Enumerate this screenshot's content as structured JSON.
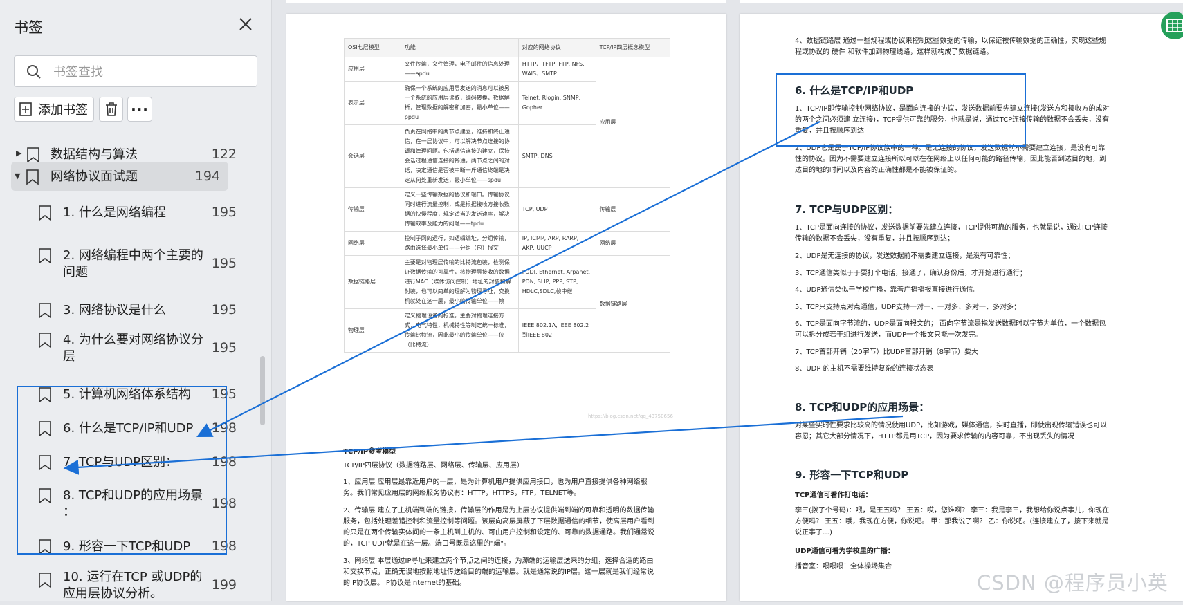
{
  "sidebar": {
    "title": "书签",
    "search_placeholder": "书签查找",
    "add_label": "添加书签",
    "bookmarks": [
      {
        "label": "数据结构与算法",
        "page": "122"
      },
      {
        "label": "网络协议面试题",
        "page": "194"
      },
      {
        "label": "1. 什么是网络编程",
        "page": "195"
      },
      {
        "label": "2. 网络编程中两个主要的",
        "label2": "问题",
        "page": "195"
      },
      {
        "label": "3. 网络协议是什么",
        "page": "195"
      },
      {
        "label": "4. 为什么要对网络协议分",
        "label2": "层",
        "page": "195"
      },
      {
        "label": "5. 计算机网络体系结构",
        "page": "195"
      },
      {
        "label": "6. 什么是TCP/IP和UDP",
        "page": "198"
      },
      {
        "label": "7. TCP与UDP区别：",
        "page": "198"
      },
      {
        "label": "8. TCP和UDP的应用场景",
        "label2": "：",
        "page": "198"
      },
      {
        "label": "9. 形容一下TCP和UDP",
        "page": "198"
      },
      {
        "label": "10. 运行在TCP 或UDP的",
        "label2": "应用层协议分析。",
        "page": "199"
      }
    ]
  },
  "osi_table": {
    "headers": [
      "OSI七层模型",
      "功能",
      "对应的网络协议",
      "TCP/IP四层概念模型"
    ],
    "rows": [
      {
        "layer": "应用层",
        "func": "文件传输，文件管理，电子邮件的信息处理——apdu",
        "proto": "HTTP、TFTP, FTP, NFS, WAIS、SMTP"
      },
      {
        "layer": "表示层",
        "func": "确保一个系统的应用层发送的消息可以被另一个系统的应用层读取，编码转换，数据解析，管理数据的解密和加密，最小单位——ppdu",
        "proto": "Telnet, Rlogin, SNMP, Gopher"
      },
      {
        "layer": "会话层",
        "func": "负责在网络中的两节点建立，维持和终止通信，在一层协议中，可以解决节点连接的协调和管理问题。包括通信连接的建立，保持会话过程通信连接的畅通，两节点之间的对话，决定通信是否被中断一斤通信终端是决定从何处重新发送，最小单位——spdu",
        "proto": "SMTP, DNS"
      },
      {
        "layer": "传输层",
        "func": "定义一些传输数据的协议和端口。传输协议同时进行流量控制，或是根据接收方接收数据的快慢程度，规定适当的发送速率，解决传输效率及能力的问题——tpdu",
        "proto": "TCP, UDP"
      },
      {
        "layer": "网络层",
        "func": "控制子网的运行，如逻辑编址，分组传输，路由选择最小单位——分组（包）报文",
        "proto": "IP, ICMP, ARP, RARP, AKP, UUCP"
      },
      {
        "layer": "数据链路层",
        "func": "主要是对物理层传输的比特流包装，检测保证数据传输的可靠性，将物理层接收的数据进行MAC（媒体访问控制）地址的封装和解封装，也可以简单的理解为物理寻址，交换机就处在这一层，最小的传输单位——帧",
        "proto": "FDDI, Ethernet, Arpanet, PDN, SLIP, PPP, STP, HDLC,SDLC,帧中继"
      },
      {
        "layer": "物理层",
        "func": "定义物理设备的标准，主要对物理连接方式，电气特性，机械特性等制定统一标准，传输比特流，因此最小的传输单位——位（比特流）",
        "proto": "IEEE 802.1A, IEEE 802.2到IEEE 802."
      }
    ],
    "tcpip_groups": [
      "应用层",
      "传输层",
      "网络层",
      "数据链路层"
    ],
    "watermark": "https://blog.csdn.net/qq_43750656"
  },
  "left_doc": {
    "heading": "TCP/IP参考模型",
    "subtitle": "TCP/IP四层协议（数据链路层、网络层、传输层、应用层）",
    "p1a": "1、应用层 应用层最靠近用户的一层，是为计算机用户提供应用接口，也为用户直接提供各种网络服",
    "p1b": "务。我们常见应用层的网络服务协议有：HTTP，HTTPS，FTP，TELNET等。",
    "p2a": "2、传输层 建立了主机端到端的链接，传输层的作用是为上层协议提供端到端的可靠和透明的数据传输",
    "p2b": "服务，包括处理差错控制和流量控制等问题。该层向高层屏蔽了下层数据通信的细节，使高层用户看到",
    "p2c": "的只是在两个传输实体间的一条主机到主机的、可由用户控制和设定的、可靠的数据通路。我们通常说",
    "p2d": "的，TCP UDP就是在这一层。端口号既是这里的\"端\"。",
    "p3a": "3、网络层 本层通过IP寻址来建立两个节点之间的连接，为源端的运输层送来的分组，选择合适的路由",
    "p3b": "和交换节点，正确无误地按照地址传送给目的端的运输层。就是通常说的IP层。这一层就是我们经常说",
    "p3c": "的IP协议层。IP协议是Internet的基础。"
  },
  "right_doc": {
    "intro_a": "4、数据链路层 通过一些规程或协议来控制这些数据的传输，以保证被传输数据的正确性。实现这些规",
    "intro_b": "程或协议的 硬件 和软件加到物理线路，这样就构成了数据链路。",
    "h6": "6. 什么是TCP/IP和UDP",
    "s6p1a": "1、TCP/IP即传输控制/网络协议，是面向连接的协议，发送数据前要先建立连接(发送方和接收方的成对",
    "s6p1b": "的两个之间必须建 立连接)，TCP提供可靠的服务，也就是说，通过TCP连接传输的数据不会丢失，没有",
    "s6p1c": "重复，并且按顺序到达",
    "s6p2a": "2、UDP它是属于TCP/IP协议族中的一种。是无连接的协议，发送数据前不需要建立连接，是没有可靠",
    "s6p2b": "性的协议。因为不需要建立连接所以可以在在网络上以任何可能的路径传输，因此能否到达目的地，到",
    "s6p2c": "达目的地的时间以及内容的正确性都是不能被保证的。",
    "h7": "7. TCP与UDP区别：",
    "s7": [
      "1、TCP是面向连接的协议，发送数据前要先建立连接，TCP提供可靠的服务，也就是说，通过TCP连接",
      "传输的数据不会丢失，没有重复，并且按顺序到达；",
      "2、UDP是无连接的协议，发送数据前不需要建立连接，是没有可靠性；",
      "3、TCP通信类似于于要打个电话，接通了，确认身份后，才开始进行通行；",
      "4、UDP通信类似于学校广播，靠着广播播报直接进行通信。",
      "5、TCP只支持点对点通信，UDP支持一对一、一对多、多对一、多对多；",
      "6、TCP是面向字节流的，UDP是面向报文的； 面向字节流是指发送数据时以字节为单位，一个数据包",
      "可以拆分成若干组进行发送，而UDP一个报文只能一次发完。",
      "7、TCP首部开销（20字节）比UDP首部开销（8字节）要大",
      "8、UDP 的主机不需要维持复杂的连接状态表"
    ],
    "h8": "8. TCP和UDP的应用场景：",
    "s8a": "对某些实时性要求比较高的情况使用UDP，比如游戏，媒体通信，实时直播，即使出现传输错误也可以",
    "s8b": "容忍；其它大部分情况下，HTTP都是用TCP，因为要求传输的内容可靠，不出现丢失的情况",
    "h9": "9. 形容一下TCP和UDP",
    "tcp_call_title": "TCP通信可看作打电话：",
    "tcp_call_a": "李三(拨了个号码)：喂，是王五吗？ 王五：哎，您谁啊？ 李三：我是李三，我想给你说点事儿，你现在",
    "tcp_call_b": "方便吗？ 王五：哦，我现在方便，你说吧。 甲：那我说了啊？ 乙：你说吧。(连接建立了，接下来就是",
    "tcp_call_c": "说正事了…)",
    "udp_title": "UDP通信可看为学校里的广播：",
    "udp_text": "播音室：喂喂喂！全体操场集合"
  },
  "watermark": "CSDN @程序员小英",
  "colors": {
    "accent_blue": "#1a6fd6",
    "sidebar_bg": "#ebedf0",
    "badge_green": "#25a05a"
  }
}
